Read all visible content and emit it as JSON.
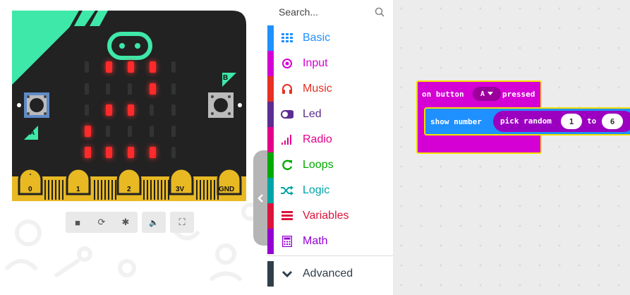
{
  "simulator": {
    "led_rows": [
      [
        0,
        1,
        1,
        1,
        0
      ],
      [
        0,
        0,
        0,
        1,
        0
      ],
      [
        0,
        1,
        1,
        0,
        0
      ],
      [
        1,
        0,
        0,
        0,
        0
      ],
      [
        1,
        1,
        1,
        1,
        0
      ]
    ],
    "button_a_label": "A",
    "button_b_label": "B",
    "pins": [
      "0",
      "1",
      "2",
      "3V",
      "GND"
    ],
    "controls": [
      {
        "name": "stop",
        "icon": "stop-icon",
        "glyph": "■"
      },
      {
        "name": "restart",
        "icon": "restart-icon",
        "glyph": "⟳"
      },
      {
        "name": "debug",
        "icon": "bug-icon",
        "glyph": "✱"
      },
      {
        "name": "mute",
        "icon": "speaker-icon",
        "glyph": "🔈"
      },
      {
        "name": "fullscreen",
        "icon": "fullscreen-icon",
        "glyph": "⛶"
      }
    ]
  },
  "toolbox": {
    "search_placeholder": "Search...",
    "categories": [
      {
        "label": "Basic",
        "color": "#1e90ff",
        "icon": "grid-icon"
      },
      {
        "label": "Input",
        "color": "#d400d4",
        "icon": "target-icon"
      },
      {
        "label": "Music",
        "color": "#e63022",
        "icon": "headphones-icon"
      },
      {
        "label": "Led",
        "color": "#5c2d91",
        "icon": "toggle-icon"
      },
      {
        "label": "Radio",
        "color": "#e3008c",
        "icon": "signal-icon"
      },
      {
        "label": "Loops",
        "color": "#00aa00",
        "icon": "refresh-icon"
      },
      {
        "label": "Logic",
        "color": "#00a4a6",
        "icon": "shuffle-icon"
      },
      {
        "label": "Variables",
        "color": "#dc143c",
        "icon": "lines-icon"
      },
      {
        "label": "Math",
        "color": "#9400d3",
        "icon": "calculator-icon"
      },
      {
        "label": "Advanced",
        "color": "#2f3f4a",
        "icon": "chevron-down-icon"
      }
    ]
  },
  "workspace": {
    "event": {
      "prefix": "on button",
      "button_value": "A",
      "suffix": "pressed"
    },
    "show_number": {
      "label": "show number",
      "pick_random": "pick random",
      "from_value": "1",
      "to_label": "to",
      "to_value": "6"
    }
  }
}
